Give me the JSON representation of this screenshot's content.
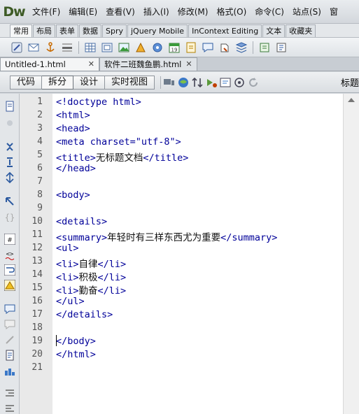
{
  "app": {
    "logo": "Dw"
  },
  "menu": [
    "文件(F)",
    "编辑(E)",
    "查看(V)",
    "插入(I)",
    "修改(M)",
    "格式(O)",
    "命令(C)",
    "站点(S)",
    "窗"
  ],
  "insert_tabs": [
    "常用",
    "布局",
    "表单",
    "数据",
    "Spry",
    "jQuery Mobile",
    "InContext Editing",
    "文本",
    "收藏夹"
  ],
  "active_insert_tab": "常用",
  "documents": [
    {
      "name": "Untitled-1.html",
      "active": true
    },
    {
      "name": "软件二班魏鱼鹏.html",
      "active": false
    }
  ],
  "view_buttons": [
    "代码",
    "拆分",
    "设计",
    "实时视图"
  ],
  "active_view": "拆分",
  "title_label": "标题",
  "code_lines": [
    {
      "n": "1",
      "code": "<!doctype html>"
    },
    {
      "n": "2",
      "code": "<html>"
    },
    {
      "n": "3",
      "code": "<head>"
    },
    {
      "n": "4",
      "code": "<meta charset=\"utf-8\">"
    },
    {
      "n": "5",
      "code": "<title>无标题文档</title>"
    },
    {
      "n": "6",
      "code": "</head>"
    },
    {
      "n": "7",
      "code": ""
    },
    {
      "n": "8",
      "code": "<body>"
    },
    {
      "n": "9",
      "code": ""
    },
    {
      "n": "10",
      "code": "<details>"
    },
    {
      "n": "11",
      "code": "<summary>年轻时有三样东西尤为重要</summary>"
    },
    {
      "n": "12",
      "code": "<ul>"
    },
    {
      "n": "13",
      "code": "<li>自律</li>"
    },
    {
      "n": "14",
      "code": "<li>积极</li>"
    },
    {
      "n": "15",
      "code": "<li>勤奋</li>"
    },
    {
      "n": "16",
      "code": "</ul>"
    },
    {
      "n": "17",
      "code": "</details>"
    },
    {
      "n": "18",
      "code": ""
    },
    {
      "n": "19",
      "code": "</body>"
    },
    {
      "n": "20",
      "code": "</html>"
    },
    {
      "n": "21",
      "code": ""
    }
  ]
}
